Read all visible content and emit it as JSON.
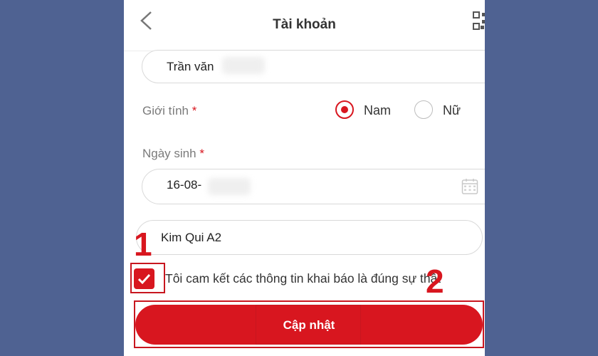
{
  "header": {
    "title": "Tài khoản",
    "back_icon": "chevron-left-icon",
    "qr_icon": "qr-code-icon"
  },
  "form": {
    "name_value": "Trần văn",
    "gender": {
      "label": "Giới tính",
      "required_mark": "*",
      "options": [
        {
          "label": "Nam",
          "selected": true
        },
        {
          "label": "Nữ",
          "selected": false
        }
      ]
    },
    "birthdate": {
      "label": "Ngày sinh",
      "required_mark": "*",
      "value": "16-08-",
      "icon": "calendar-icon"
    },
    "address_value": "Kim Qui A2",
    "consent": {
      "checked": true,
      "text": "Tôi cam kết các thông tin khai báo là đúng sự thật"
    },
    "submit_label": "Cập nhật"
  },
  "annotations": {
    "marker_1": "1",
    "marker_2": "2"
  },
  "colors": {
    "accent": "#d8161f",
    "background": "#4f6292"
  }
}
